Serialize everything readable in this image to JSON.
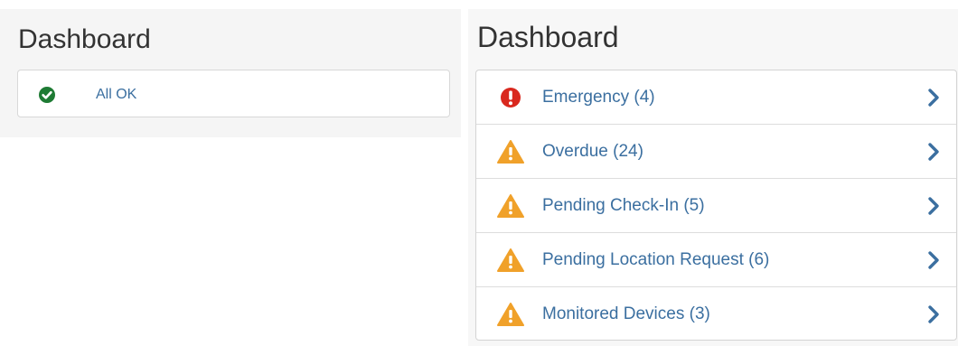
{
  "left_panel": {
    "title": "Dashboard",
    "status": {
      "icon": "check-circle-icon",
      "label": "All OK",
      "color": "#1e7b34"
    }
  },
  "right_panel": {
    "title": "Dashboard",
    "items": [
      {
        "label": "Emergency (4)",
        "icon": "exclamation-circle-icon",
        "color": "#d9281e"
      },
      {
        "label": "Overdue (24)",
        "icon": "warning-triangle-icon",
        "color": "#f0a12a"
      },
      {
        "label": "Pending Check-In (5)",
        "icon": "warning-triangle-icon",
        "color": "#f0a12a"
      },
      {
        "label": "Pending Location Request (6)",
        "icon": "warning-triangle-icon",
        "color": "#f0a12a"
      },
      {
        "label": "Monitored Devices (3)",
        "icon": "warning-triangle-icon",
        "color": "#f0a12a"
      }
    ],
    "chevron_icon": "chevron-right-icon",
    "link_color": "#3b6fa0"
  }
}
